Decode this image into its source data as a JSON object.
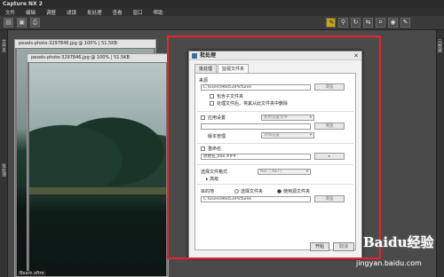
{
  "app_title": "Capture NX 2",
  "menu": [
    "文件",
    "编辑",
    "调整",
    "滤镜",
    "批处理",
    "查看",
    "窗口",
    "帮助"
  ],
  "left_strip_labels": [
    "文件夹",
    "批处理"
  ],
  "right_strip_labels": [
    "元数据"
  ],
  "doc_back_title": "pexels-photo-3297846.jpg @ 100% | 51.5KB",
  "doc_front_title": "pexels-photo-3297846.jpg @ 100% | 51.5KB",
  "bottom_label": "Beam aftre",
  "dialog": {
    "title": "批处理",
    "close": "✕",
    "tabs": [
      "批处理",
      "监视文件夹"
    ],
    "source_label": "来源",
    "source_path": "C:\\Users\\96053\\Pictures",
    "browse_label": "浏览",
    "include_subfolders": "包含子文件夹",
    "delete_after": "处理文件后，将其从此文件夹中删除",
    "apply_settings": "应用设置",
    "settings_select": "使用设置文件",
    "version_mgmt": "版本管理",
    "version_select": "添加设置",
    "rename": "重命名",
    "rename_value": "原始名_000.###",
    "format_label": "选择文件格式",
    "format_value": "NEF (.NEF)",
    "advanced": "高级",
    "dest_label": "目的地",
    "dest_opt1": "选择文件夹",
    "dest_opt2": "使用源文件夹",
    "dest_path": "C:\\Users\\96053\\Pictures",
    "start": "开始",
    "cancel": "取消"
  },
  "watermark": {
    "logo": "Baidu经验",
    "url": "jingyan.baidu.com"
  }
}
